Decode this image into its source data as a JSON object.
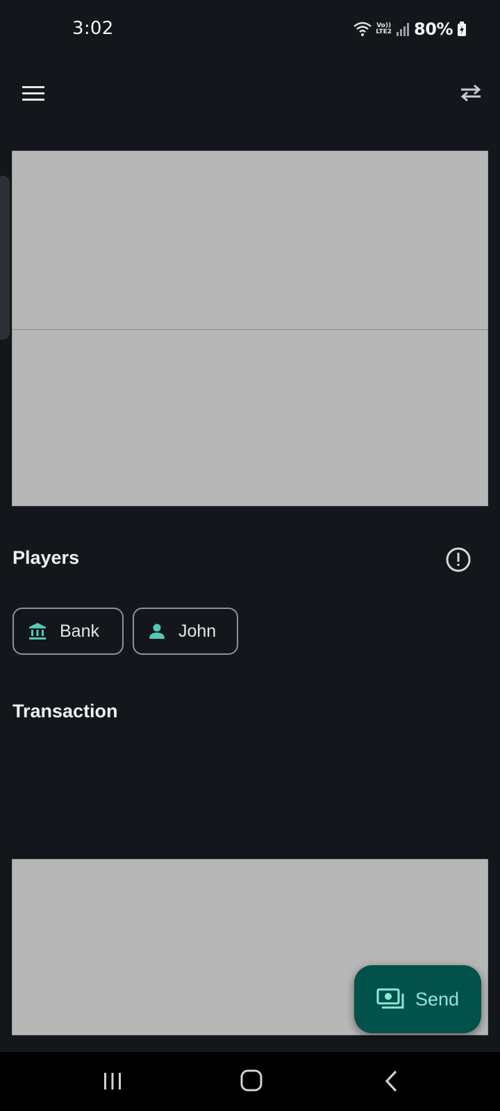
{
  "status_bar": {
    "time": "3:02",
    "battery": "80%",
    "network": "LTE2",
    "voip": "Vo))",
    "icons": [
      "wifi-icon",
      "lte-icon",
      "signal-icon",
      "battery-charging-icon"
    ]
  },
  "app_bar": {
    "left_icon": "menu-icon",
    "right_icon": "swap-icon"
  },
  "players": {
    "title": "Players",
    "info_icon": "info-icon",
    "chips": [
      {
        "label": "Bank",
        "icon": "bank-icon"
      },
      {
        "label": "John",
        "icon": "person-icon"
      }
    ]
  },
  "transaction": {
    "title": "Transaction"
  },
  "fab": {
    "label": "Send",
    "icon": "money-icon"
  },
  "nav": {
    "icons": [
      "recents-icon",
      "home-icon",
      "back-icon"
    ]
  },
  "colors": {
    "background": "#13161b",
    "accent": "#56c8b6",
    "fab_bg": "#02514b",
    "fab_text": "#8ee8d8",
    "placeholder": "#b7b7b7"
  }
}
